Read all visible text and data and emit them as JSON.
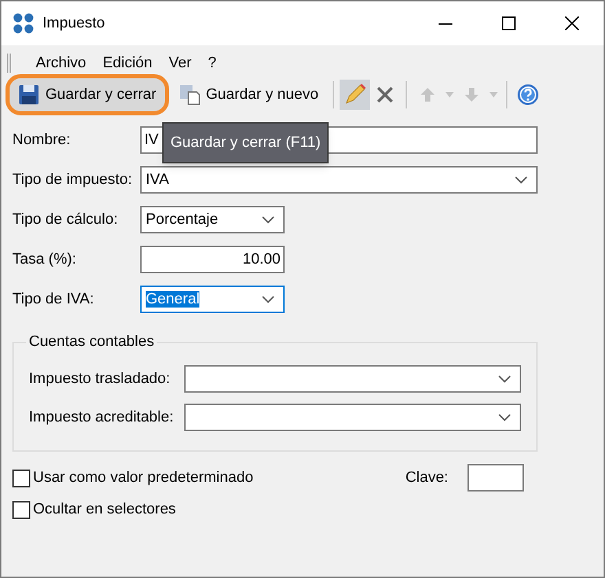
{
  "window": {
    "title": "Impuesto"
  },
  "menu": [
    {
      "label": "Archivo"
    },
    {
      "label": "Edición"
    },
    {
      "label": "Ver"
    },
    {
      "label": "?"
    }
  ],
  "toolbar": [
    {
      "kind": "save",
      "label": "Guardar y cerrar",
      "highlighted": true
    },
    {
      "kind": "save_new",
      "label": "Guardar y nuevo",
      "highlighted": false
    },
    {
      "kind": "separator"
    },
    {
      "kind": "edit",
      "pressed": true
    },
    {
      "kind": "delete",
      "pressed": false
    },
    {
      "kind": "separator"
    },
    {
      "kind": "up",
      "disabled": true
    },
    {
      "kind": "dropdown",
      "disabled": true
    },
    {
      "kind": "down",
      "disabled": true
    },
    {
      "kind": "dropdown",
      "disabled": true
    },
    {
      "kind": "separator"
    },
    {
      "kind": "help"
    }
  ],
  "tooltip": {
    "text": "Guardar y cerrar (F11)"
  },
  "fields": [
    {
      "kind": "text",
      "label": "Nombre:",
      "value": "IV"
    },
    {
      "kind": "combo",
      "label": "Tipo de impuesto:",
      "value": "IVA",
      "focused": false
    },
    {
      "kind": "combo",
      "label": "Tipo de cálculo:",
      "value": "Porcentaje",
      "focused": false
    },
    {
      "kind": "number",
      "label": "Tasa (%):",
      "value": "10.00"
    },
    {
      "kind": "combo",
      "label": "Tipo de IVA:",
      "value": "General",
      "focused": true
    }
  ],
  "group": {
    "title": "Cuentas contables",
    "fields": [
      {
        "label": "Impuesto trasladado:"
      },
      {
        "label": "Impuesto acreditable:"
      }
    ]
  },
  "checkboxes": [
    {
      "label": "Usar como valor predeterminado",
      "checked": false
    },
    {
      "label": "Ocultar en selectores",
      "checked": false
    }
  ],
  "clave": {
    "label": "Clave:"
  }
}
